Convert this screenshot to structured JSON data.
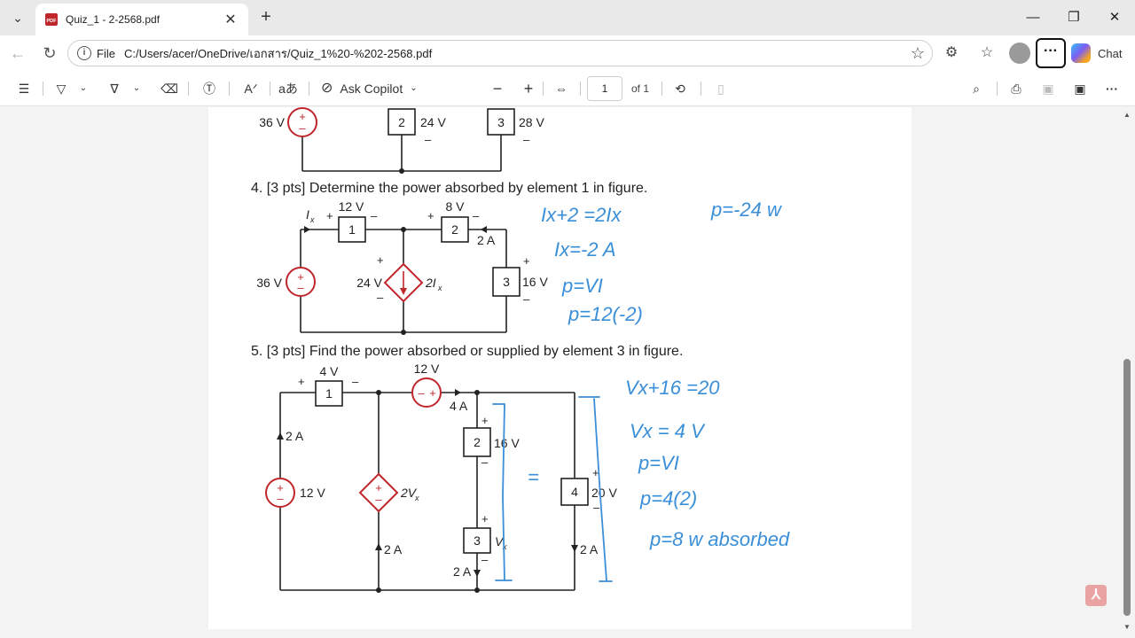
{
  "tab": {
    "title": "Quiz_1 - 2-2568.pdf"
  },
  "address": {
    "file_label": "File",
    "url": "C:/Users/acer/OneDrive/เอกสาร/Quiz_1%20-%202-2568.pdf"
  },
  "chat_label": "Chat",
  "toolbar": {
    "read_aloud": "Aᐟ",
    "translate": "aあ",
    "copilot_label": "Ask Copilot",
    "page_current": "1",
    "page_total": "of 1"
  },
  "doc": {
    "q3": {
      "source_v": "36 V",
      "e2_id": "2",
      "e2_v": "24 V",
      "e3_id": "3",
      "e3_v": "28 V"
    },
    "q4": {
      "question": "4. [3 pts] Determine the power absorbed by element 1 in figure.",
      "v1": "12 V",
      "v2": "8 V",
      "ix": "I",
      "ix_sub": "x",
      "e1": "1",
      "e2": "2",
      "e3": "3",
      "src": "36 V",
      "dep_v": "24 V",
      "dep_label": "2I",
      "dep_sub": "x",
      "cur_2a": "2 A",
      "v3": "16 V",
      "plus": "+",
      "minus": "–"
    },
    "q5": {
      "question": "5. [3 pts] Find the power absorbed or supplied by element 3 in figure.",
      "v1": "4 V",
      "src_top": "12 V",
      "cur_4a": "4 A",
      "cur_2a": "2 A",
      "e1": "1",
      "e2": "2",
      "e3": "3",
      "e4": "4",
      "src_left": "12 V",
      "dep_label": "2V",
      "dep_sub": "x",
      "v2": "16 V",
      "v4": "20 V",
      "vx": "V",
      "vx_sub": "x"
    },
    "handwriting_q4": [
      "Ix+2 =2Ix",
      "p=-24 w",
      "Ix=-2 A",
      "p=VI",
      "p=12(-2)"
    ],
    "handwriting_q5": [
      "Vx+16 =20",
      "Vx = 4 V",
      "p=VI",
      "p=4(2)",
      "p=8 w absorbed",
      "="
    ]
  },
  "colors": {
    "source_red": "#c0272d",
    "ink_blue": "#3a8fd8"
  }
}
